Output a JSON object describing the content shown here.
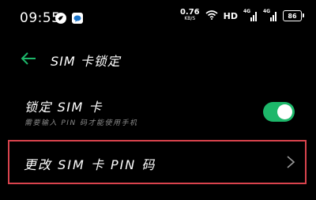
{
  "status_bar": {
    "time": "09:55",
    "net_speed_value": "0.76",
    "net_speed_unit": "KB/S",
    "hd_label": "HD",
    "signal1_tag": "4G",
    "signal2_tag": "4G",
    "battery_level": "86"
  },
  "header": {
    "title": "SIM 卡锁定"
  },
  "lock_setting": {
    "label": "锁定 SIM 卡",
    "description": "需要输入 PIN 码才能使用手机",
    "enabled": true,
    "toggle_color": "#1db76a"
  },
  "change_pin": {
    "label": "更改 SIM 卡 PIN 码",
    "highlight_color": "#d9434d"
  }
}
